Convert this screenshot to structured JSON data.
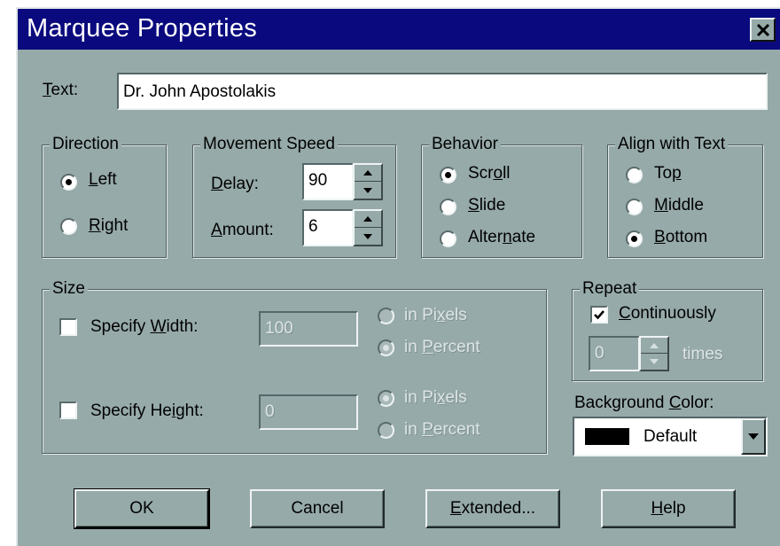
{
  "window": {
    "title": "Marquee Properties"
  },
  "text_field": {
    "label": "Text:",
    "value": "Dr. John Apostolakis"
  },
  "direction": {
    "legend": "Direction",
    "options": [
      {
        "label": "Left",
        "selected": true
      },
      {
        "label": "Right",
        "selected": false
      }
    ]
  },
  "movement_speed": {
    "legend": "Movement Speed",
    "delay_label": "Delay:",
    "delay_value": "90",
    "amount_label": "Amount:",
    "amount_value": "6"
  },
  "behavior": {
    "legend": "Behavior",
    "options": [
      {
        "label": "Scroll",
        "selected": true
      },
      {
        "label": "Slide",
        "selected": false
      },
      {
        "label": "Alternate",
        "selected": false
      }
    ]
  },
  "align": {
    "legend": "Align with Text",
    "options": [
      {
        "label": "Top",
        "selected": false
      },
      {
        "label": "Middle",
        "selected": false
      },
      {
        "label": "Bottom",
        "selected": true
      }
    ]
  },
  "size": {
    "legend": "Size",
    "width": {
      "label": "Specify Width:",
      "checked": false,
      "value": "100",
      "unit_options": [
        {
          "label": "in Pixels",
          "selected": false
        },
        {
          "label": "in Percent",
          "selected": true
        }
      ]
    },
    "height": {
      "label": "Specify Height:",
      "checked": false,
      "value": "0",
      "unit_options": [
        {
          "label": "in Pixels",
          "selected": true
        },
        {
          "label": "in Percent",
          "selected": false
        }
      ]
    }
  },
  "repeat": {
    "legend": "Repeat",
    "continuously_label": "Continuously",
    "continuously_checked": true,
    "times_value": "0",
    "times_label": "times"
  },
  "background_color": {
    "label": "Background Color:",
    "value": "Default",
    "swatch_color": "#000000"
  },
  "buttons": {
    "ok": "OK",
    "cancel": "Cancel",
    "extended": "Extended...",
    "help": "Help"
  },
  "colors": {
    "dialog_face": "#97aaaa",
    "title_bar": "#0a0a7e"
  }
}
